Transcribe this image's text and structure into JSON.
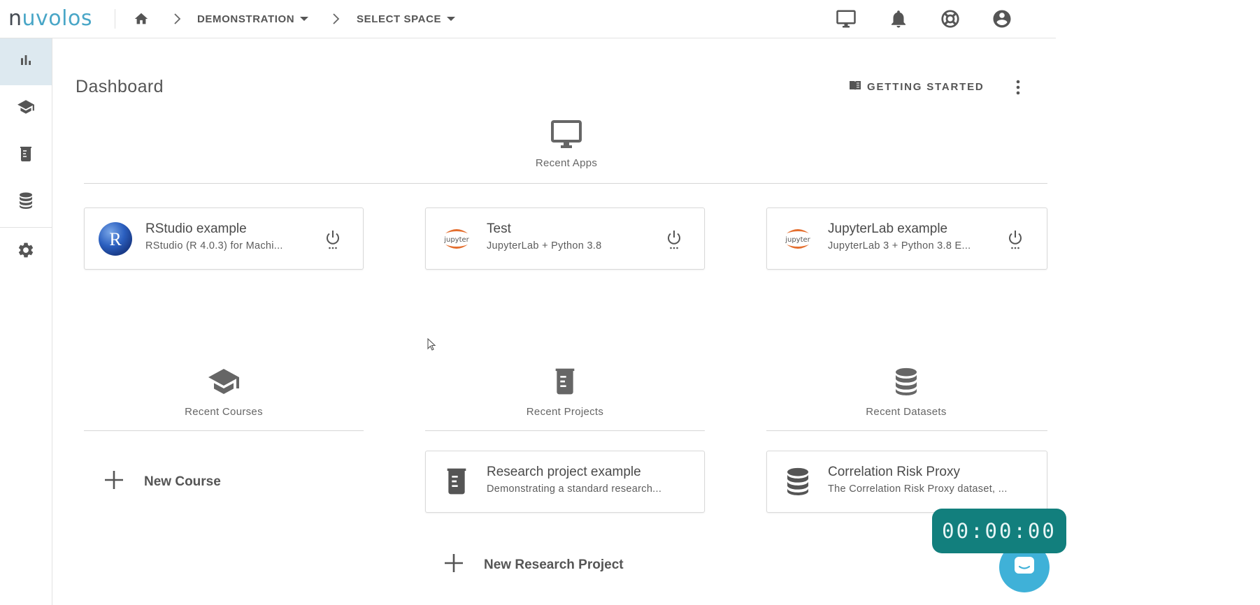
{
  "app": {
    "logo_n": "n",
    "logo_rest": "uvolos",
    "accent_color": "#49a6c7",
    "timer_color": "#127f7d"
  },
  "breadcrumb": {
    "home_icon": "home-icon",
    "items": [
      {
        "label": "DEMONSTRATION"
      },
      {
        "label": "SELECT SPACE"
      }
    ]
  },
  "topbar_icons": [
    "monitor-icon",
    "bell-icon",
    "lifebuoy-icon",
    "account-icon"
  ],
  "sidenav": {
    "items": [
      {
        "icon": "bar-chart-icon",
        "active": true
      },
      {
        "icon": "graduation-cap-icon",
        "active": false
      },
      {
        "icon": "beaker-icon",
        "active": false
      },
      {
        "icon": "database-icon",
        "active": false
      },
      {
        "icon": "gear-icon",
        "active": false
      }
    ]
  },
  "page": {
    "title": "Dashboard",
    "getting_started": "GETTING STARTED"
  },
  "recent_apps": {
    "label": "Recent Apps",
    "cards": [
      {
        "title": "RStudio example",
        "subtitle": "RStudio (R 4.0.3) for Machi...",
        "icon": "r-logo-icon"
      },
      {
        "title": "Test",
        "subtitle": "JupyterLab + Python 3.8",
        "icon": "jupyter-logo-icon",
        "logo_text": "jupyter"
      },
      {
        "title": "JupyterLab example",
        "subtitle": "JupyterLab 3 + Python 3.8 E...",
        "icon": "jupyter-logo-icon",
        "logo_text": "jupyter"
      }
    ]
  },
  "recent_courses": {
    "label": "Recent Courses",
    "new_label": "New Course"
  },
  "recent_projects": {
    "label": "Recent Projects",
    "cards": [
      {
        "title": "Research project example",
        "subtitle": "Demonstrating a standard research..."
      }
    ],
    "new_label": "New Research Project"
  },
  "recent_datasets": {
    "label": "Recent Datasets",
    "cards": [
      {
        "title": "Correlation Risk Proxy",
        "subtitle": "The Correlation Risk Proxy dataset, ..."
      }
    ]
  },
  "timer": {
    "value": "00:00:00"
  }
}
